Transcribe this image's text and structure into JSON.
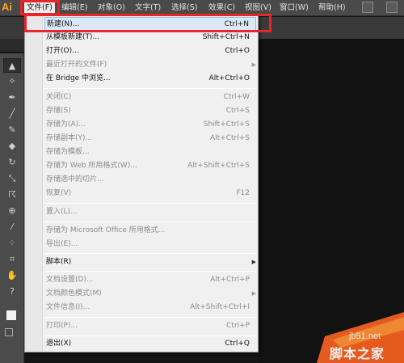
{
  "menubar": {
    "logo": "Ai",
    "items": [
      {
        "label": "文件(F)",
        "active": true
      },
      {
        "label": "编辑(E)"
      },
      {
        "label": "对象(O)"
      },
      {
        "label": "文字(T)"
      },
      {
        "label": "选择(S)"
      },
      {
        "label": "效果(C)"
      },
      {
        "label": "视图(V)"
      },
      {
        "label": "窗口(W)"
      },
      {
        "label": "帮助(H)"
      }
    ]
  },
  "file_menu": {
    "items": [
      {
        "label": "新建(N)...",
        "shortcut": "Ctrl+N",
        "highlighted": true
      },
      {
        "label": "从模板新建(T)...",
        "shortcut": "Shift+Ctrl+N"
      },
      {
        "label": "打开(O)...",
        "shortcut": "Ctrl+O"
      },
      {
        "label": "最近打开的文件(F)",
        "submenu": true,
        "disabled": true
      },
      {
        "label": "在 Bridge 中浏览...",
        "shortcut": "Alt+Ctrl+O"
      },
      {
        "label": "关闭(C)",
        "shortcut": "Ctrl+W",
        "disabled": true
      },
      {
        "label": "存储(S)",
        "shortcut": "Ctrl+S",
        "disabled": true
      },
      {
        "label": "存储为(A)...",
        "shortcut": "Shift+Ctrl+S",
        "disabled": true
      },
      {
        "label": "存储副本(Y)...",
        "shortcut": "Alt+Ctrl+S",
        "disabled": true
      },
      {
        "label": "存储为模板...",
        "disabled": true
      },
      {
        "label": "存储为 Web 所用格式(W)...",
        "shortcut": "Alt+Shift+Ctrl+S",
        "disabled": true
      },
      {
        "label": "存储选中的切片...",
        "disabled": true
      },
      {
        "label": "恢复(V)",
        "shortcut": "F12",
        "disabled": true
      },
      {
        "label": "置入(L)...",
        "disabled": true
      },
      {
        "label": "存储为 Microsoft Office 所用格式...",
        "disabled": true
      },
      {
        "label": "导出(E)...",
        "disabled": true
      },
      {
        "label": "脚本(R)",
        "submenu": true
      },
      {
        "label": "文档设置(D)...",
        "shortcut": "Alt+Ctrl+P",
        "disabled": true
      },
      {
        "label": "文档颜色模式(M)",
        "submenu": true,
        "disabled": true
      },
      {
        "label": "文件信息(I)...",
        "shortcut": "Alt+Shift+Ctrl+I",
        "disabled": true
      },
      {
        "label": "打印(P)...",
        "shortcut": "Ctrl+P",
        "disabled": true
      },
      {
        "label": "退出(X)",
        "shortcut": "Ctrl+Q"
      }
    ]
  },
  "watermark": {
    "url": "jb51.net",
    "site_name": "脚本之家"
  },
  "colors": {
    "accent_red": "#e8262a",
    "logo_orange": "#f7a51c",
    "menu_bg": "#f0f0f0",
    "highlight": "#dbe8f8"
  },
  "icons": {
    "tools": [
      "selection-tool-icon",
      "magic-wand-icon",
      "pen-icon",
      "line-icon",
      "paintbrush-icon",
      "eraser-icon",
      "rotate-icon",
      "scale-icon",
      "warp-icon",
      "shape-builder-icon",
      "eyedropper-icon",
      "symbol-sprayer-icon",
      "artboard-icon",
      "hand-icon",
      "help-icon"
    ]
  }
}
